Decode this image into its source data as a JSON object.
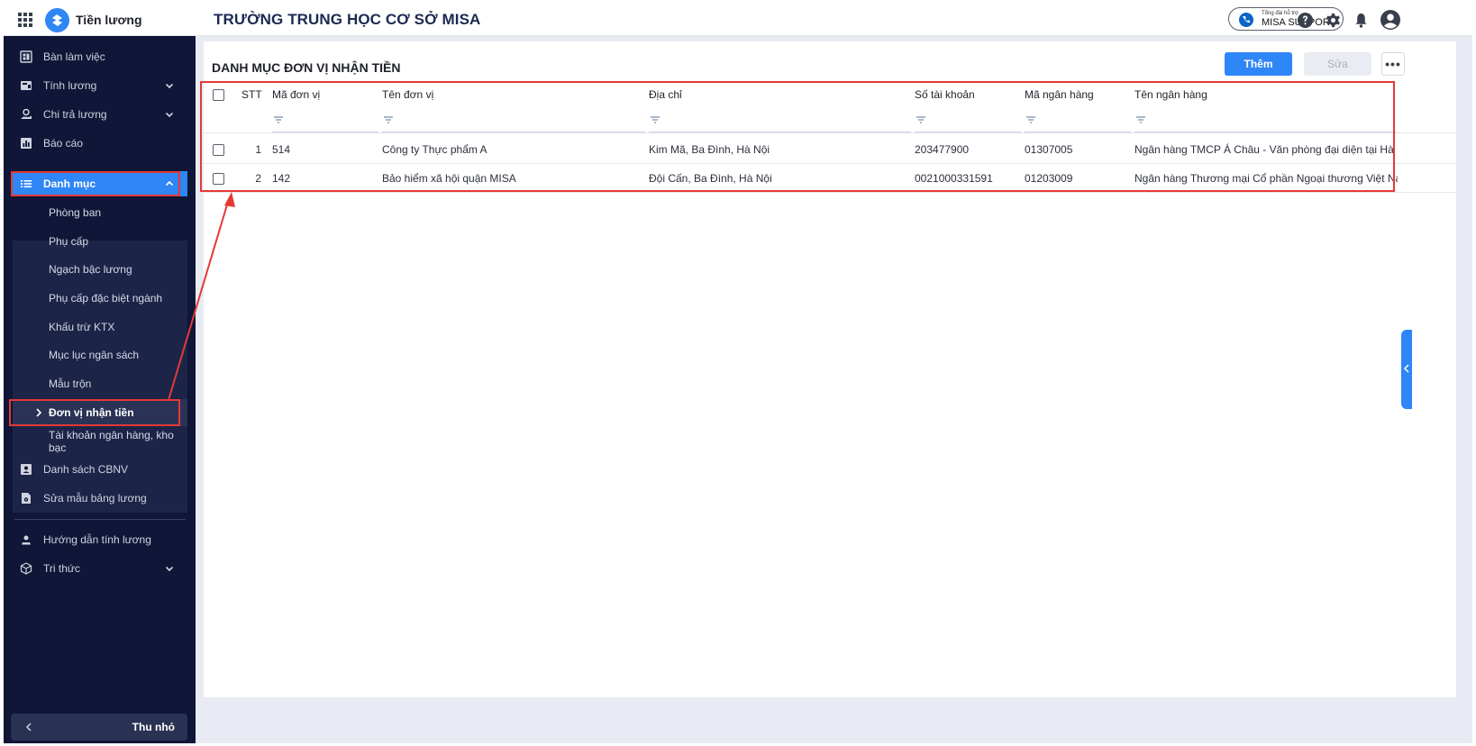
{
  "app": {
    "name": "Tiền lương",
    "org": "TRƯỜNG TRUNG HỌC CƠ SỞ MISA"
  },
  "support": {
    "small": "Tổng đài hỗ trợ",
    "label": "MISA SUPPORT"
  },
  "sidebar": {
    "items": [
      {
        "label": "Bàn làm việc"
      },
      {
        "label": "Tính lương"
      },
      {
        "label": "Chi trả lương"
      },
      {
        "label": "Báo cáo"
      },
      {
        "label": "Danh mục"
      }
    ],
    "sub_items": [
      {
        "label": "Phòng ban"
      },
      {
        "label": "Phụ cấp"
      },
      {
        "label": "Ngạch bậc lương"
      },
      {
        "label": "Phụ cấp đặc biệt ngành"
      },
      {
        "label": "Khấu trừ KTX"
      },
      {
        "label": "Mục lục ngân sách"
      },
      {
        "label": "Mẫu trộn"
      },
      {
        "label": "Đơn vị nhận tiền"
      },
      {
        "label": "Tài khoản ngân hàng, kho bạc"
      }
    ],
    "bottom_items": [
      {
        "label": "Danh sách CBNV"
      },
      {
        "label": "Sửa mẫu bảng lương"
      },
      {
        "label": "Hướng dẫn tính lương"
      },
      {
        "label": "Tri thức"
      }
    ],
    "collapse_label": "Thu nhỏ"
  },
  "page": {
    "title": "DANH MỤC ĐƠN VỊ NHẬN TIỀN",
    "add_label": "Thêm",
    "edit_label": "Sửa"
  },
  "table": {
    "columns": [
      "STT",
      "Mã đơn vị",
      "Tên đơn vị",
      "Địa chỉ",
      "Số tài khoản",
      "Mã ngân hàng",
      "Tên ngân hàng"
    ],
    "rows": [
      {
        "stt": "1",
        "code": "514",
        "name": "Công ty Thực phẩm A",
        "address": "Kim Mã, Ba Đình, Hà Nội",
        "account": "203477900",
        "bank_code": "01307005",
        "bank_name": "Ngân hàng TMCP Á Châu - Văn phòng đại diện tại Hà Nội"
      },
      {
        "stt": "2",
        "code": "142",
        "name": "Bảo hiểm xã hội quận MISA",
        "address": "Đội Cấn, Ba Đình, Hà Nội",
        "account": "0021000331591",
        "bank_code": "01203009",
        "bank_name": "Ngân hàng Thương mại Cổ phần Ngoại thương Việt Nam - C..."
      }
    ]
  },
  "colors": {
    "accent": "#2f86f6",
    "sidebar_bg": "#0f1637",
    "highlight": "#e53935"
  }
}
